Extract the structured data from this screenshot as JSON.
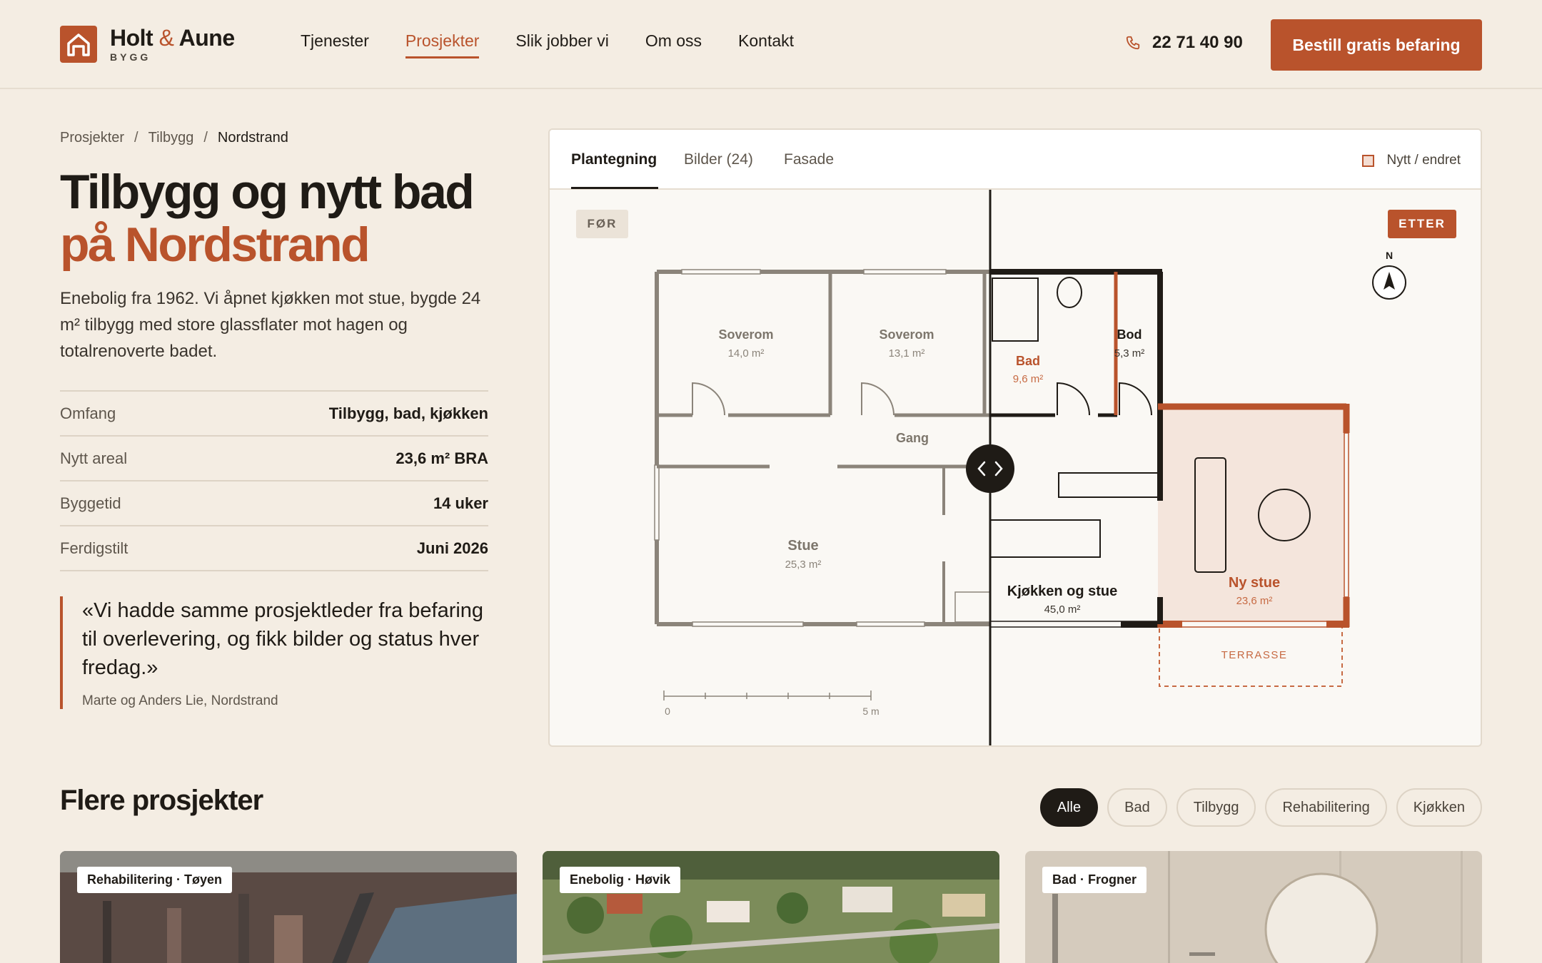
{
  "brand": {
    "name_part1": "Holt",
    "amp": "&",
    "name_part2": "Aune",
    "sub": "BYGG",
    "accent": "#b9532c"
  },
  "nav": [
    {
      "label": "Tjenester",
      "active": false
    },
    {
      "label": "Prosjekter",
      "active": true
    },
    {
      "label": "Slik jobber vi",
      "active": false
    },
    {
      "label": "Om oss",
      "active": false
    },
    {
      "label": "Kontakt",
      "active": false
    }
  ],
  "header": {
    "phone": "22 71 40 90",
    "cta": "Bestill gratis befaring"
  },
  "breadcrumb": {
    "items": [
      "Prosjekter",
      "Tilbygg",
      "Nordstrand"
    ],
    "sep": "/"
  },
  "project": {
    "title_line1": "Tilbygg og nytt bad",
    "title_line2": "på Nordstrand",
    "lead": "Enebolig fra 1962. Vi åpnet kjøkken mot stue, bygde 24 m² tilbygg med store glassflater mot hagen og totalrenoverte badet.",
    "facts": [
      {
        "label": "Omfang",
        "value": "Tilbygg, bad, kjøkken"
      },
      {
        "label": "Nytt areal",
        "value": "23,6 m² BRA"
      },
      {
        "label": "Byggetid",
        "value": "14 uker"
      },
      {
        "label": "Ferdigstilt",
        "value": "Juni 2026"
      }
    ],
    "quote": "«Vi hadde samme prosjektleder fra befaring til overlevering, og fikk bilder og status hver fredag.»",
    "quote_author": "Marte og Anders Lie, Nordstrand"
  },
  "viewer": {
    "tabs": [
      {
        "label": "Plantegning",
        "active": true
      },
      {
        "label": "Bilder (24)",
        "active": false
      },
      {
        "label": "Fasade",
        "active": false
      }
    ],
    "legend": "Nytt / endret",
    "before_label": "FØR",
    "after_label": "ETTER",
    "north": "N",
    "rooms": {
      "soverom1": {
        "name": "Soverom",
        "area": "14,0 m²"
      },
      "soverom2": {
        "name": "Soverom",
        "area": "13,1 m²"
      },
      "gang": {
        "name": "Gang"
      },
      "stue": {
        "name": "Stue",
        "area": "25,3 m²"
      },
      "bad": {
        "name": "Bad",
        "area": "9,6 m²"
      },
      "bod": {
        "name": "Bod",
        "area": "5,3 m²"
      },
      "kjokken": {
        "name": "Kjøkken og stue",
        "area": "45,0 m²"
      },
      "nystue": {
        "name": "Ny stue",
        "area": "23,6 m²"
      },
      "terrasse": {
        "name": "TERRASSE"
      }
    },
    "scale": {
      "start": "0",
      "end": "5 m"
    }
  },
  "more": {
    "title": "Flere prosjekter",
    "filters": [
      {
        "label": "Alle",
        "active": true
      },
      {
        "label": "Bad",
        "active": false
      },
      {
        "label": "Tilbygg",
        "active": false
      },
      {
        "label": "Rehabilitering",
        "active": false
      },
      {
        "label": "Kjøkken",
        "active": false
      }
    ],
    "cards": [
      {
        "tag": "Rehabilitering · Tøyen"
      },
      {
        "tag": "Enebolig · Høvik"
      },
      {
        "tag": "Bad · Frogner"
      }
    ]
  }
}
